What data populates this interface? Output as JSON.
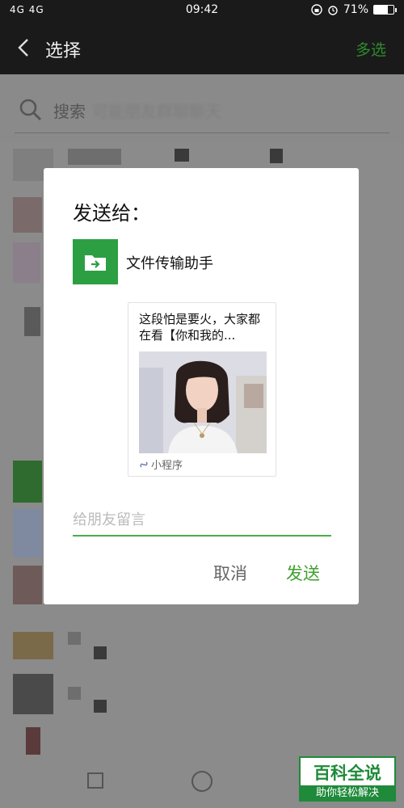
{
  "status_bar": {
    "network": "4G 4G",
    "time": "09:42",
    "battery_percent": "71%",
    "battery_level": 0.71
  },
  "header": {
    "title": "选择",
    "multi_select": "多选"
  },
  "search": {
    "placeholder": "搜索",
    "blurred_text": "可能朋友群聊聊天"
  },
  "dialog": {
    "title": "发送给：",
    "recipient": "文件传输助手",
    "card_text": "这段怕是要火，大家都在看【你和我的...",
    "card_footer": "小程序",
    "message_placeholder": "给朋友留言",
    "cancel": "取消",
    "send": "发送"
  },
  "watermark": {
    "top": "百科全说",
    "bottom": "助你轻松解决"
  },
  "colors": {
    "accent_green": "#2d9f43",
    "title_bar": "#1a1a1a",
    "overlay_gray": "#8b8b8b"
  },
  "icons": [
    "back-icon",
    "search-icon",
    "folder-icon",
    "miniprogram-icon",
    "alarm-icon",
    "lock-rotation-icon",
    "battery-icon"
  ]
}
